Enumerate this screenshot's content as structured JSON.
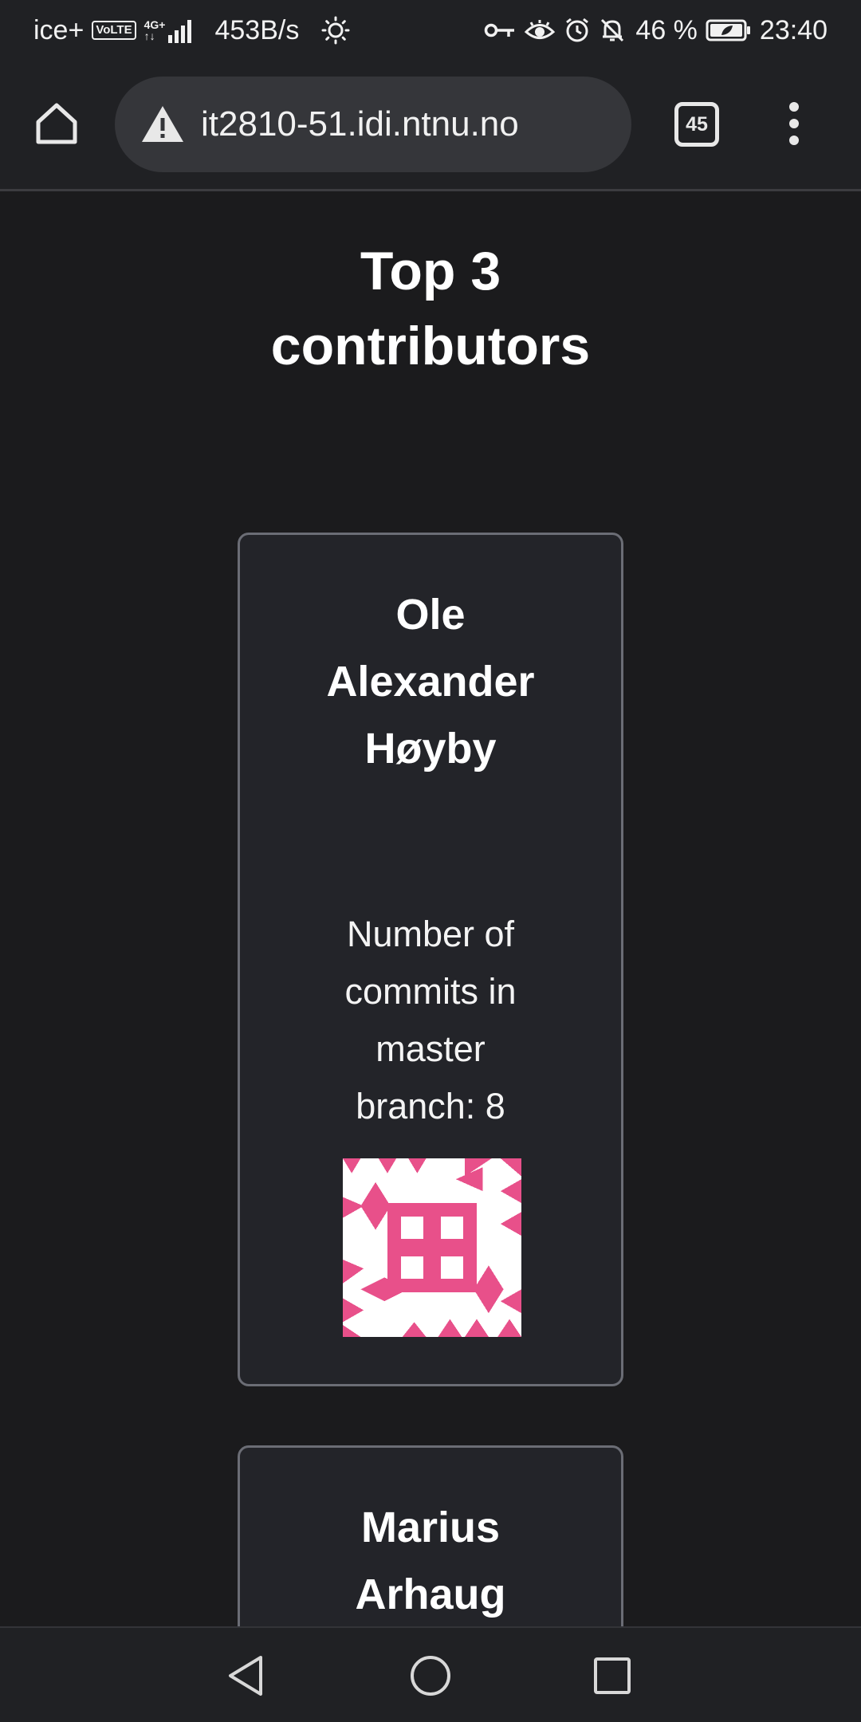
{
  "status_bar": {
    "carrier": "ice+",
    "volte": "VoLTE",
    "network_type": "4G+",
    "network_sub": "↑↓",
    "speed": "453B/s",
    "battery_percent": "46 %",
    "time": "23:40",
    "icons": [
      "brightness-icon",
      "key-icon",
      "eye-icon",
      "alarm-icon",
      "bell-off-icon",
      "battery-icon",
      "signal-icon"
    ]
  },
  "browser": {
    "url": "it2810-51.idi.ntnu.no",
    "tab_count": "45",
    "icons": [
      "home-icon",
      "warning-icon",
      "tabs-icon",
      "menu-icon"
    ]
  },
  "page": {
    "title": "Top 3 contributors",
    "contributors": [
      {
        "name": "Ole Alexander Høyby",
        "stat": "Number of commits in master branch: 8",
        "avatar_color": "#e8508a"
      },
      {
        "name": "Marius Arhaug"
      }
    ]
  },
  "nav_bar": {
    "icons": [
      "back-icon",
      "home-circle-icon",
      "recents-icon"
    ]
  },
  "colors": {
    "background": "#1b1b1d",
    "card": "#232429",
    "card_border": "#6b6d75",
    "chrome": "#202124",
    "omnibox": "#35363a"
  }
}
